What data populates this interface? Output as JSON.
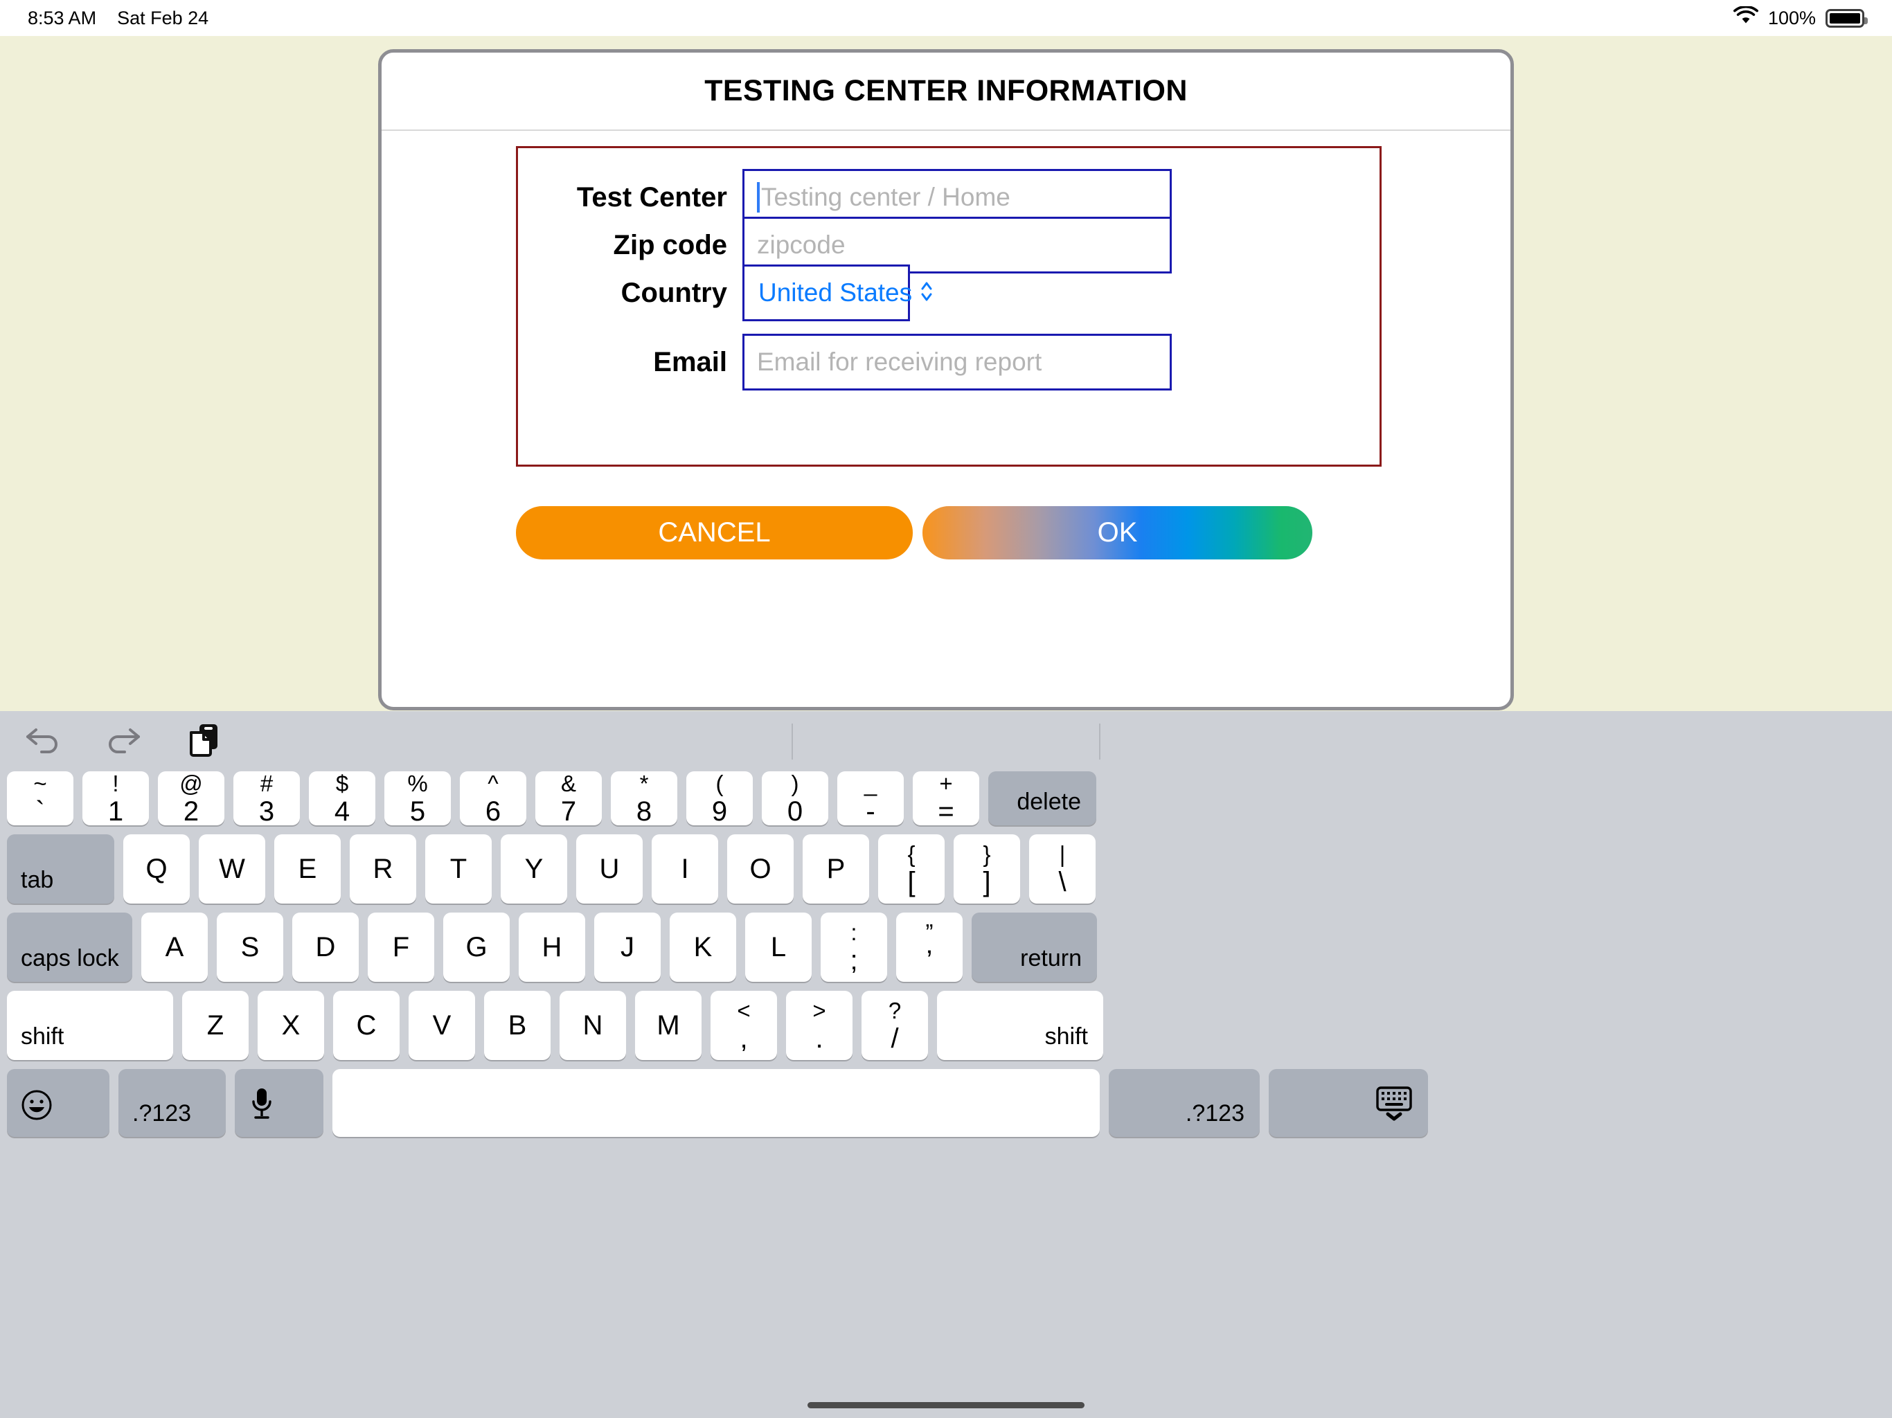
{
  "status_bar": {
    "time": "8:53 AM",
    "date": "Sat Feb 24",
    "battery_percent": "100%",
    "wifi_icon": "wifi-icon",
    "battery_icon": "battery-full-icon"
  },
  "dialog": {
    "title": "TESTING CENTER INFORMATION",
    "fields": [
      {
        "label": "Test Center",
        "placeholder": "Testing center / Home",
        "value": "",
        "type": "text",
        "focused": true
      },
      {
        "label": "Zip code",
        "placeholder": "zipcode",
        "value": "",
        "type": "text",
        "focused": false
      },
      {
        "label": "Country",
        "placeholder": "",
        "value": "United States",
        "type": "select",
        "focused": false
      },
      {
        "label": "Email",
        "placeholder": "Email for receiving report",
        "value": "",
        "type": "text",
        "focused": false
      }
    ],
    "country_options": [
      "United States"
    ],
    "buttons": {
      "cancel": "CANCEL",
      "ok": "OK"
    },
    "colors": {
      "cancel_bg": "#f79000",
      "ok_gradient_start": "#f7941e",
      "ok_gradient_mid": "#1a80f0",
      "ok_gradient_end": "#22b573",
      "form_border": "#8b1a1a",
      "input_border": "#1a1ab0",
      "select_text": "#0a7bff",
      "app_background": "#f0f0d8"
    }
  },
  "keyboard": {
    "toolbar": [
      {
        "icon": "undo-icon"
      },
      {
        "icon": "redo-icon"
      },
      {
        "icon": "paste-icon"
      }
    ],
    "rows": {
      "number": [
        {
          "top": "~",
          "bot": "`"
        },
        {
          "top": "!",
          "bot": "1"
        },
        {
          "top": "@",
          "bot": "2"
        },
        {
          "top": "#",
          "bot": "3"
        },
        {
          "top": "$",
          "bot": "4"
        },
        {
          "top": "%",
          "bot": "5"
        },
        {
          "top": "^",
          "bot": "6"
        },
        {
          "top": "&",
          "bot": "7"
        },
        {
          "top": "*",
          "bot": "8"
        },
        {
          "top": "(",
          "bot": "9"
        },
        {
          "top": ")",
          "bot": "0"
        },
        {
          "top": "_",
          "bot": "-"
        },
        {
          "top": "+",
          "bot": "="
        }
      ],
      "number_modifier": "delete",
      "qwerty_modifier": "tab",
      "qwerty": [
        "Q",
        "W",
        "E",
        "R",
        "T",
        "Y",
        "U",
        "I",
        "O",
        "P"
      ],
      "qwerty_symbols": [
        {
          "top": "{",
          "bot": "["
        },
        {
          "top": "}",
          "bot": "]"
        },
        {
          "top": "|",
          "bot": "\\"
        }
      ],
      "home_modifier_left": "caps lock",
      "home": [
        "A",
        "S",
        "D",
        "F",
        "G",
        "H",
        "J",
        "K",
        "L"
      ],
      "home_symbols": [
        {
          "top": ":",
          "bot": ";"
        },
        {
          "top": "”",
          "bot": "’"
        }
      ],
      "home_modifier_right": "return",
      "bottom_modifier_left": "shift",
      "bottom": [
        "Z",
        "X",
        "C",
        "V",
        "B",
        "N",
        "M"
      ],
      "bottom_symbols": [
        {
          "top": "<",
          "bot": ","
        },
        {
          "top": ">",
          "bot": "."
        },
        {
          "top": "?",
          "bot": "/"
        }
      ],
      "bottom_modifier_right": "shift",
      "last": {
        "emoji_icon": "emoji-smiley-icon",
        "numeric_left": ".?123",
        "mic_icon": "microphone-icon",
        "space": "",
        "numeric_right": ".?123",
        "dismiss_icon": "dismiss-keyboard-icon"
      }
    }
  }
}
